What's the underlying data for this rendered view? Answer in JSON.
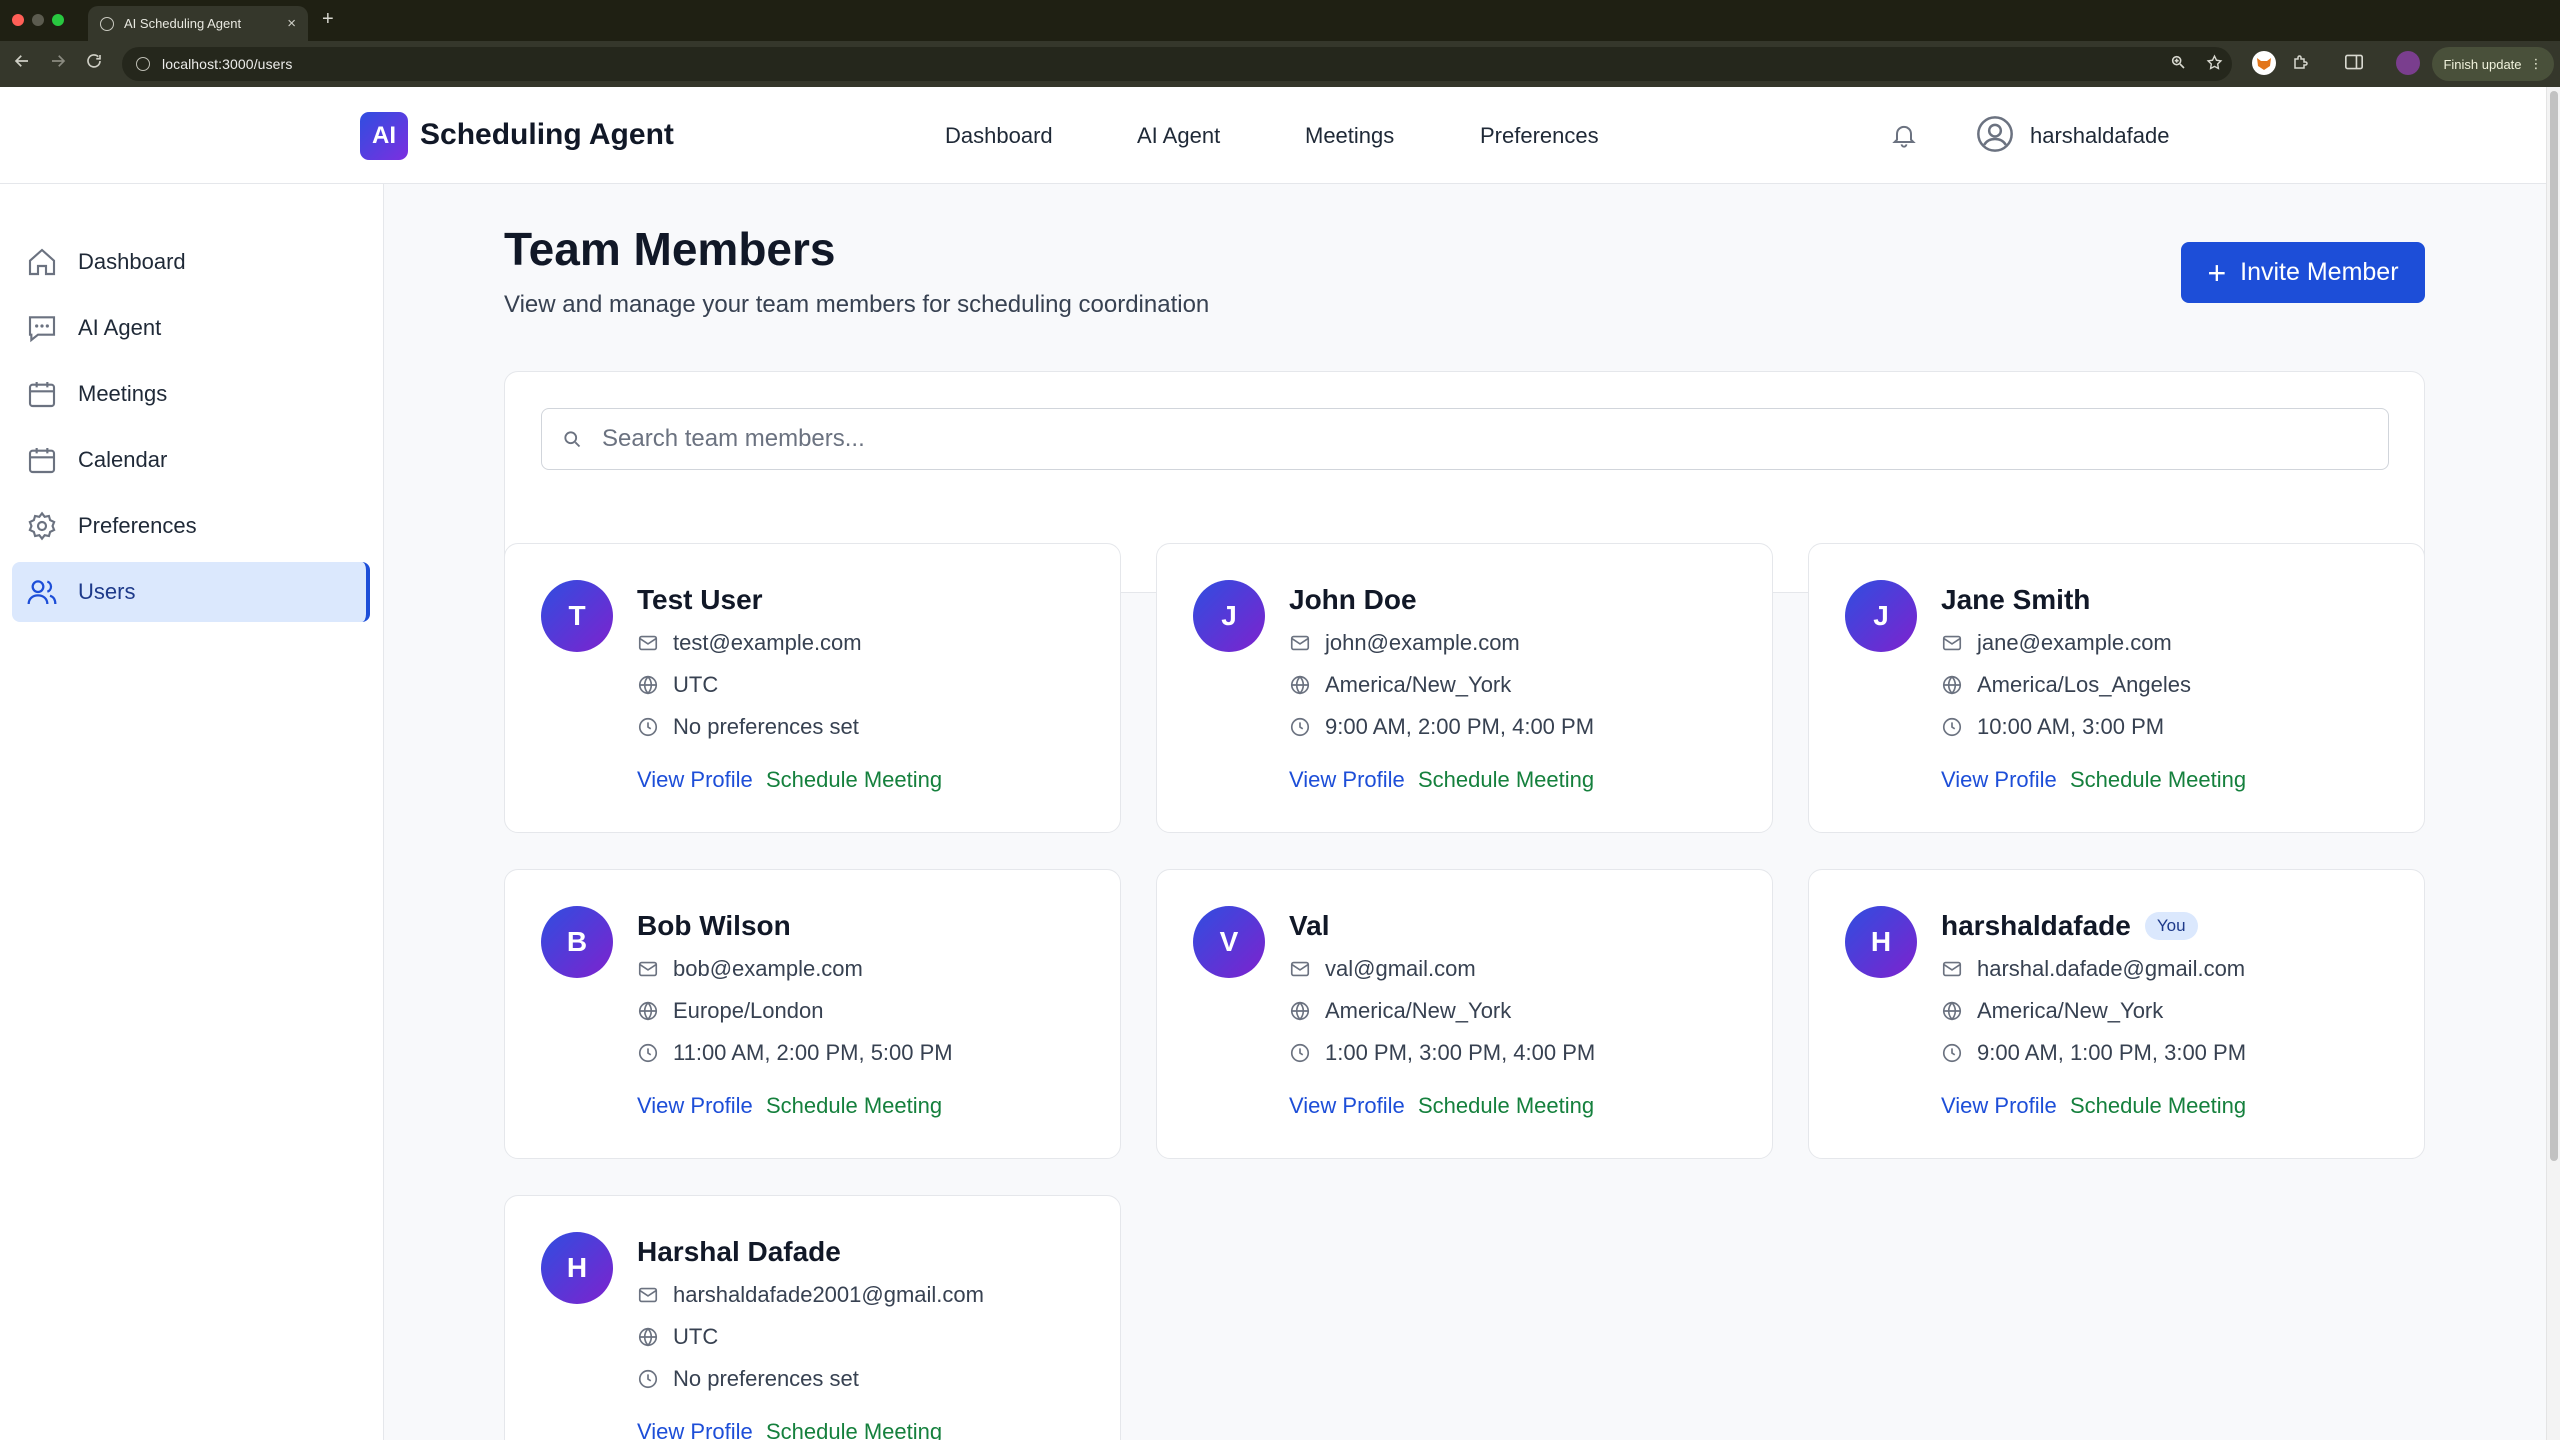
{
  "browser": {
    "tab_title": "AI Scheduling Agent",
    "tab_close": "×",
    "new_tab": "+",
    "url": "localhost:3000/users",
    "finish_update": "Finish update",
    "finish_update_menu": "⋮"
  },
  "header": {
    "logo_badge": "AI",
    "logo_text": "Scheduling Agent",
    "nav": [
      "Dashboard",
      "AI Agent",
      "Meetings",
      "Preferences"
    ],
    "username": "harshaldafade"
  },
  "sidebar": {
    "items": [
      {
        "label": "Dashboard",
        "icon": "home-icon"
      },
      {
        "label": "AI Agent",
        "icon": "chat-icon"
      },
      {
        "label": "Meetings",
        "icon": "calendar-icon"
      },
      {
        "label": "Calendar",
        "icon": "calendar-icon"
      },
      {
        "label": "Preferences",
        "icon": "gear-icon"
      },
      {
        "label": "Users",
        "icon": "users-icon",
        "active": true
      }
    ]
  },
  "page": {
    "title": "Team Members",
    "subtitle": "View and manage your team members for scheduling coordination",
    "invite_label": "Invite Member",
    "invite_icon": "+",
    "search_placeholder": "Search team members..."
  },
  "members": [
    {
      "initial": "T",
      "name": "Test User",
      "email": "test@example.com",
      "timezone": "UTC",
      "times": "No preferences set",
      "view": "View Profile",
      "schedule": "Schedule Meeting"
    },
    {
      "initial": "J",
      "name": "John Doe",
      "email": "john@example.com",
      "timezone": "America/New_York",
      "times": "9:00 AM, 2:00 PM, 4:00 PM",
      "view": "View Profile",
      "schedule": "Schedule Meeting"
    },
    {
      "initial": "J",
      "name": "Jane Smith",
      "email": "jane@example.com",
      "timezone": "America/Los_Angeles",
      "times": "10:00 AM, 3:00 PM",
      "view": "View Profile",
      "schedule": "Schedule Meeting"
    },
    {
      "initial": "B",
      "name": "Bob Wilson",
      "email": "bob@example.com",
      "timezone": "Europe/London",
      "times": "11:00 AM, 2:00 PM, 5:00 PM",
      "view": "View Profile",
      "schedule": "Schedule Meeting"
    },
    {
      "initial": "V",
      "name": "Val",
      "email": "val@gmail.com",
      "timezone": "America/New_York",
      "times": "1:00 PM, 3:00 PM, 4:00 PM",
      "view": "View Profile",
      "schedule": "Schedule Meeting"
    },
    {
      "initial": "H",
      "name": "harshaldafade",
      "badge": "You",
      "email": "harshal.dafade@gmail.com",
      "timezone": "America/New_York",
      "times": "9:00 AM, 1:00 PM, 3:00 PM",
      "view": "View Profile",
      "schedule": "Schedule Meeting"
    },
    {
      "initial": "H",
      "name": "Harshal Dafade",
      "email": "harshaldafade2001@gmail.com",
      "timezone": "UTC",
      "times": "No preferences set",
      "view": "View Profile",
      "schedule": "Schedule Meeting"
    }
  ],
  "colors": {
    "accent": "#1d4ed8",
    "schedule_link": "#15803d",
    "active_sidebar_bg": "#dbe8fd",
    "avatar_gradient_start": "#2f4ee0",
    "avatar_gradient_end": "#7e22ce"
  }
}
